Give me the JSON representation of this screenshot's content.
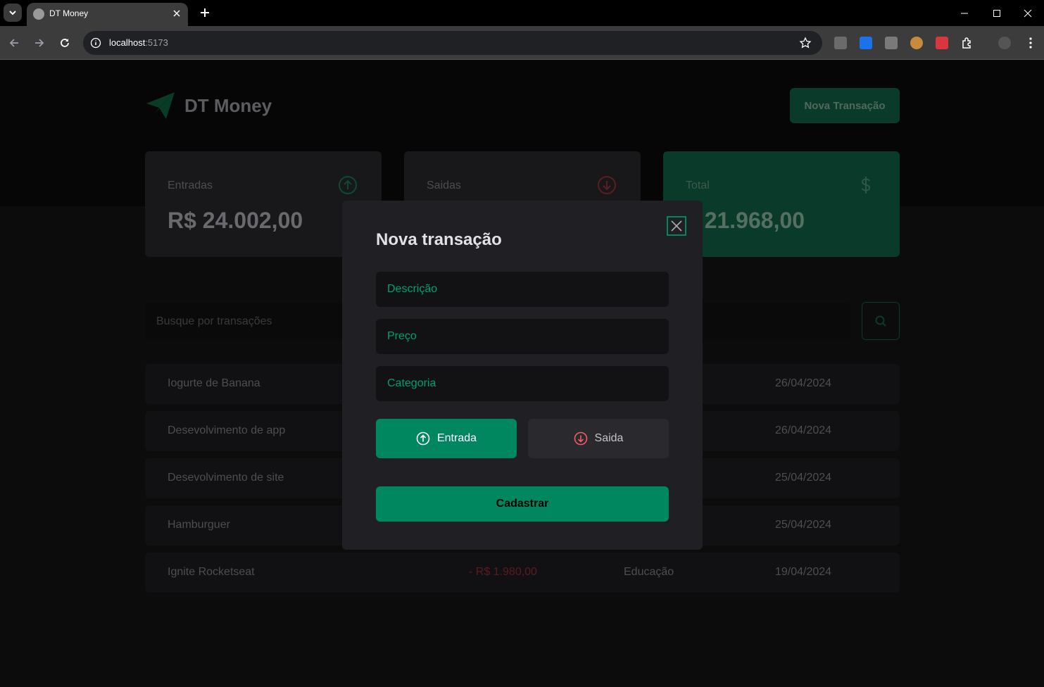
{
  "browser": {
    "tab_title": "DT Money",
    "url_host": "localhost",
    "url_port": ":5173"
  },
  "app": {
    "brand": "DT Money",
    "new_transaction_label": "Nova Transação",
    "accent_color": "#00875f",
    "danger_color": "#f75a68"
  },
  "summary": {
    "income_label": "Entradas",
    "income_value": "R$ 24.002,00",
    "outcome_label": "Saidas",
    "total_label": "Total",
    "total_value": "$ 21.968,00"
  },
  "search": {
    "placeholder": "Busque por transações"
  },
  "transactions": [
    {
      "description": "Iogurte de Banana",
      "price": "",
      "category": "",
      "date": "26/04/2024"
    },
    {
      "description": "Desevolvimento de app",
      "price": "",
      "category": "",
      "date": "26/04/2024"
    },
    {
      "description": "Desevolvimento de site",
      "price": "",
      "category": "",
      "date": "25/04/2024"
    },
    {
      "description": "Hamburguer",
      "price": "",
      "category": "",
      "date": "25/04/2024"
    },
    {
      "description": "Ignite Rocketseat",
      "price": "- R$ 1.980,00",
      "category": "Educação",
      "date": "19/04/2024"
    }
  ],
  "modal": {
    "title": "Nova transação",
    "description_placeholder": "Descrição",
    "price_placeholder": "Preço",
    "category_placeholder": "Categoria",
    "income_option": "Entrada",
    "outcome_option": "Saida",
    "selected_type": "Entrada",
    "submit_label": "Cadastrar"
  }
}
